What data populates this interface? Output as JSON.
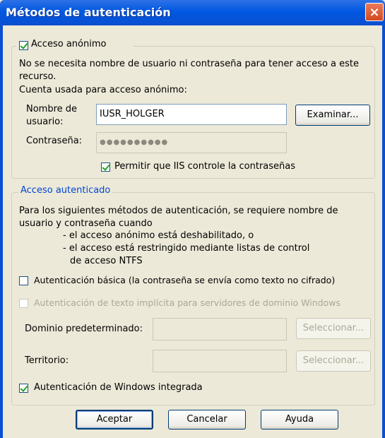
{
  "window": {
    "title": "Métodos de autenticación",
    "close_glyph": "×"
  },
  "anonymous": {
    "checkbox_label": "Acceso anónimo",
    "checked": true,
    "description": "No se necesita nombre de usuario ni contraseña para tener acceso a este recurso.",
    "account_label": "Cuenta usada para acceso anónimo:",
    "username_label": "Nombre de usuario:",
    "username_value": "IUSR_HOLGER",
    "browse_button": "Examinar...",
    "password_label": "Contraseña:",
    "password_value": "●●●●●●●●●●",
    "iis_password_label": "Permitir que IIS controle la contraseñas",
    "iis_password_checked": true
  },
  "authenticated": {
    "legend": "Acceso autenticado",
    "description": "Para los siguientes métodos de autenticación, se requiere nombre de usuario y contraseña cuando",
    "bullet1": "- el acceso anónimo está deshabilitado, o",
    "bullet2_line1": "- el acceso está restringido mediante listas de control",
    "bullet2_line2": "de acceso NTFS",
    "basic_label": "Autenticación básica (la contraseña se envía como texto no cifrado)",
    "basic_checked": false,
    "digest_label": "Autenticación de texto implícita para servidores de dominio Windows",
    "digest_checked": false,
    "domain_label": "Dominio predeterminado:",
    "domain_value": "",
    "domain_select_button": "Seleccionar...",
    "realm_label": "Territorio:",
    "realm_value": "",
    "realm_select_button": "Seleccionar...",
    "windows_label": "Autenticación de Windows integrada",
    "windows_checked": true
  },
  "buttons": {
    "ok": "Aceptar",
    "cancel": "Cancelar",
    "help": "Ayuda"
  },
  "colors": {
    "titlebar": "#0058E0",
    "face": "#ECE9D8",
    "legend_text": "#0046D5"
  },
  "icons": {
    "close": "close-icon",
    "check": "checkmark-icon"
  }
}
